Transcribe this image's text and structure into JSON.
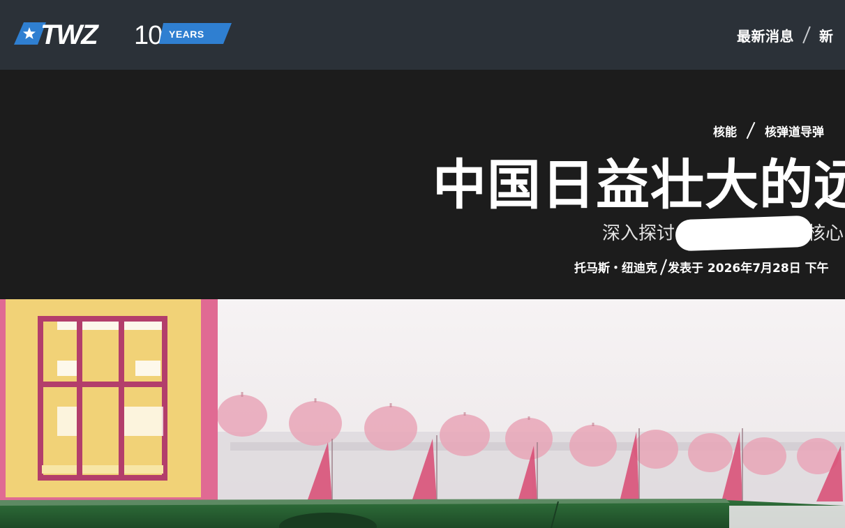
{
  "header": {
    "logo": {
      "wordmark": "TWZ",
      "anniversary_number": "10",
      "anniversary_label": "YEARS",
      "star_icon": "star-icon"
    },
    "nav": {
      "items": [
        {
          "label": "最新消息"
        },
        {
          "label": "新"
        }
      ]
    }
  },
  "article": {
    "breadcrumb": [
      "核能",
      "核弹道导弹"
    ],
    "title": "中国日益壮大的远",
    "subtitle_start": "深入探讨",
    "subtitle_end": "核心",
    "byline": {
      "author": "托马斯・纽迪克",
      "published": "发表于 2026年7月28日 下午"
    }
  },
  "feature_image": {
    "description_icon": "photo-icon"
  },
  "colors": {
    "header_bg": "#2b3138",
    "hero_bg": "#1c1c1c",
    "logo_blue": "#2f7fd1",
    "text_primary": "#ffffff"
  }
}
